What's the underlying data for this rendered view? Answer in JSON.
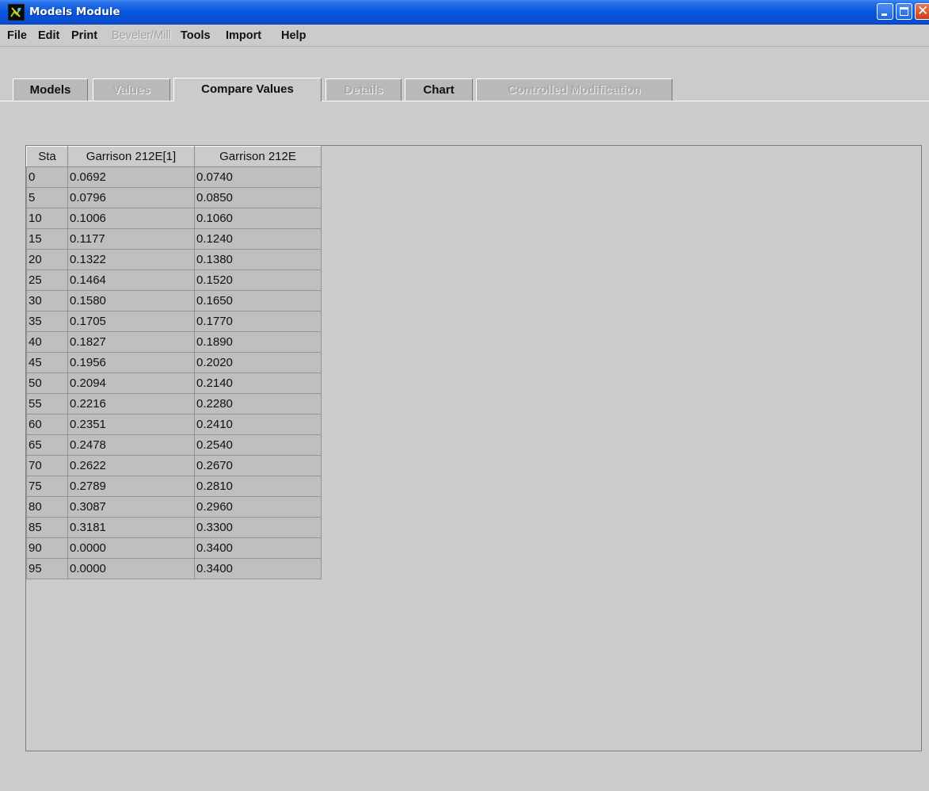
{
  "window": {
    "title": "Models Module",
    "app_icon": "java-app-icon",
    "controls": {
      "minimize": "minimize-icon",
      "maximize": "maximize-icon",
      "close": "close-icon"
    },
    "title_colors": {
      "bar": "#0a58e0",
      "text": "#ffffff",
      "close_button": "#c5401c"
    }
  },
  "menubar": {
    "items": [
      {
        "label": "File",
        "enabled": true
      },
      {
        "label": "Edit",
        "enabled": true
      },
      {
        "label": "Print",
        "enabled": true
      },
      {
        "label": "Beveler/Mill",
        "enabled": false
      },
      {
        "label": "Tools",
        "enabled": true
      },
      {
        "label": "Import",
        "enabled": true
      },
      {
        "label": "Help",
        "enabled": true
      }
    ]
  },
  "tabs": [
    {
      "label": "Models",
      "enabled": true,
      "selected": false
    },
    {
      "label": "Values",
      "enabled": false,
      "selected": false
    },
    {
      "label": "Compare Values",
      "enabled": true,
      "selected": true
    },
    {
      "label": "Details",
      "enabled": false,
      "selected": false
    },
    {
      "label": "Chart",
      "enabled": true,
      "selected": false
    },
    {
      "label": "Controlled Modification",
      "enabled": false,
      "selected": false
    }
  ],
  "table": {
    "columns": [
      "Sta",
      "Garrison 212E[1]",
      "Garrison 212E"
    ],
    "rows": [
      [
        "0",
        "0.0692",
        "0.0740"
      ],
      [
        "5",
        "0.0796",
        "0.0850"
      ],
      [
        "10",
        "0.1006",
        "0.1060"
      ],
      [
        "15",
        "0.1177",
        "0.1240"
      ],
      [
        "20",
        "0.1322",
        "0.1380"
      ],
      [
        "25",
        "0.1464",
        "0.1520"
      ],
      [
        "30",
        "0.1580",
        "0.1650"
      ],
      [
        "35",
        "0.1705",
        "0.1770"
      ],
      [
        "40",
        "0.1827",
        "0.1890"
      ],
      [
        "45",
        "0.1956",
        "0.2020"
      ],
      [
        "50",
        "0.2094",
        "0.2140"
      ],
      [
        "55",
        "0.2216",
        "0.2280"
      ],
      [
        "60",
        "0.2351",
        "0.2410"
      ],
      [
        "65",
        "0.2478",
        "0.2540"
      ],
      [
        "70",
        "0.2622",
        "0.2670"
      ],
      [
        "75",
        "0.2789",
        "0.2810"
      ],
      [
        "80",
        "0.3087",
        "0.2960"
      ],
      [
        "85",
        "0.3181",
        "0.3300"
      ],
      [
        "90",
        "0.0000",
        "0.3400"
      ],
      [
        "95",
        "0.0000",
        "0.3400"
      ]
    ]
  }
}
